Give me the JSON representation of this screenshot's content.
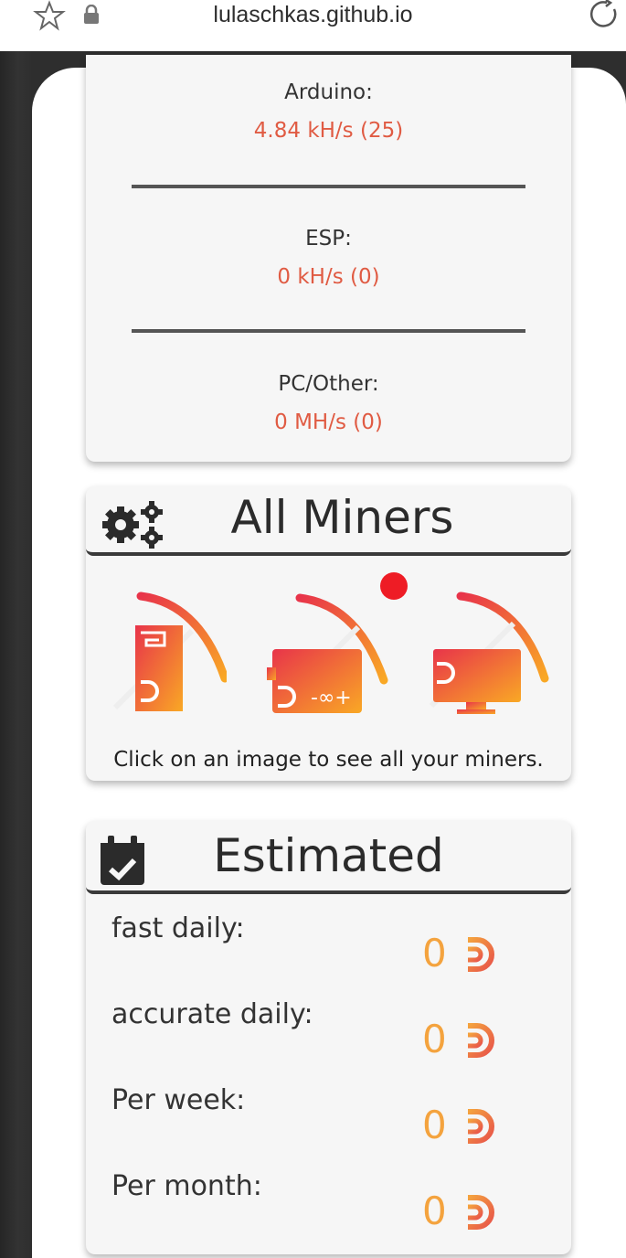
{
  "browser": {
    "url": "lulaschkas.github.io",
    "bookmark_icon": "star-icon",
    "secure_icon": "lock-icon",
    "reload_icon": "reload-icon"
  },
  "hashrates": [
    {
      "label": "Arduino:",
      "value": "4.84 kH/s (25)"
    },
    {
      "label": "ESP:",
      "value": "0 kH/s (0)"
    },
    {
      "label": "PC/Other:",
      "value": "0 MH/s (0)"
    }
  ],
  "miners": {
    "title": "All Miners",
    "icon": "gears-icon",
    "devices": [
      "esp-miner",
      "arduino-miner",
      "pc-miner"
    ],
    "hint": "Click on an image to see all your miners."
  },
  "estimated": {
    "title": "Estimated",
    "icon": "calendar-check-icon",
    "rows": [
      {
        "label": "fast daily:",
        "value": "0"
      },
      {
        "label": "accurate daily:",
        "value": "0"
      },
      {
        "label": "Per week:",
        "value": "0"
      },
      {
        "label": "Per month:",
        "value": "0"
      }
    ]
  },
  "colors": {
    "accent": "#e05b43",
    "coin": "#f4a33e",
    "title_text": "#2b2b2b"
  }
}
